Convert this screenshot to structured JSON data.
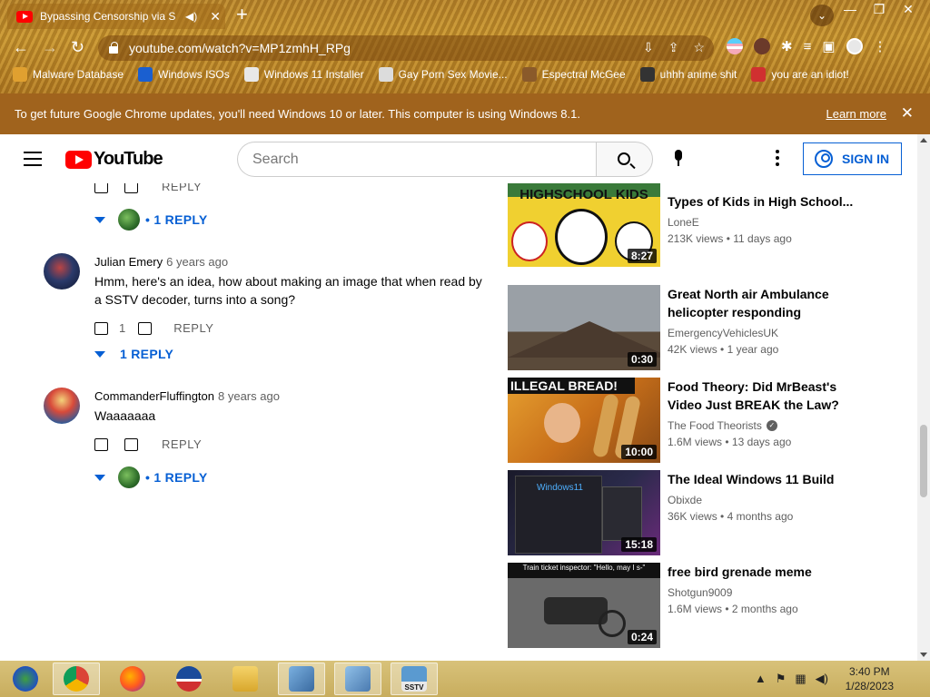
{
  "browser": {
    "tab_title": "Bypassing Censorship via SSTV",
    "url": "youtube.com/watch?v=MP1zmhH_RPg",
    "bookmarks": [
      {
        "label": "Malware Database",
        "color": "#e0a030"
      },
      {
        "label": "Windows ISOs",
        "color": "#1a5fd0"
      },
      {
        "label": "Windows 11 Installer",
        "color": "#e8e8e8"
      },
      {
        "label": "Gay Porn Sex Movie...",
        "color": "#dcdcdc"
      },
      {
        "label": "Espectral McGee",
        "color": "#8a5a2a"
      },
      {
        "label": "uhhh anime shit",
        "color": "#333333"
      },
      {
        "label": "you are an idiot!",
        "color": "#d03030"
      }
    ],
    "infobar_text": "To get future Google Chrome updates, you'll need Windows 10 or later. This computer is using Windows 8.1.",
    "infobar_link": "Learn more"
  },
  "youtube": {
    "logo_text": "YouTube",
    "search_placeholder": "Search",
    "signin_label": "SIGN IN"
  },
  "comments": {
    "top_reply_label": "REPLY",
    "top_replies_toggle": "• 1 REPLY",
    "items": [
      {
        "author": "Julian Emery",
        "time": "6 years ago",
        "text": "Hmm, here's an idea, how about making an image that when read by a SSTV decoder, turns into a song?",
        "likes": "1",
        "reply_label": "REPLY",
        "replies_toggle": "1 REPLY"
      },
      {
        "author": "CommanderFluffington",
        "time": "8 years ago",
        "text": "Waaaaaaa",
        "reply_label": "REPLY",
        "replies_toggle": "• 1 REPLY"
      }
    ]
  },
  "related": [
    {
      "title": "Types of Kids in High School...",
      "channel": "LoneE",
      "views": "213K views",
      "age": "11 days ago",
      "duration": "8:27",
      "thumb_text": "HIGHSCHOOL KIDS"
    },
    {
      "title": "Great North air Ambulance helicopter responding",
      "channel": "EmergencyVehiclesUK",
      "views": "42K views",
      "age": "1 year ago",
      "duration": "0:30"
    },
    {
      "title": "Food Theory: Did MrBeast's Video Just BREAK the Law?",
      "channel": "The Food Theorists",
      "views": "1.6M views",
      "age": "13 days ago",
      "duration": "10:00",
      "thumb_text": "ILLEGAL BREAD!"
    },
    {
      "title": "The Ideal Windows 11 Build",
      "channel": "Obixde",
      "views": "36K views",
      "age": "4 months ago",
      "duration": "15:18",
      "thumb_text": "Windows11"
    },
    {
      "title": "free bird grenade meme",
      "channel": "Shotgun9009",
      "views": "1.6M views",
      "age": "2 months ago",
      "duration": "0:24",
      "thumb_text": "Train ticket inspector: \"Hello, may I s-\""
    }
  ],
  "taskbar": {
    "time": "3:40 PM",
    "date": "1/28/2023",
    "apps": [
      "windows-media-center",
      "chrome",
      "firefox",
      "obama-logo-app",
      "file-explorer",
      "network-app",
      "network-app-2",
      "sstv-app"
    ],
    "sstv_label": "SSTV"
  },
  "colors": {
    "accent_blue": "#065fd4",
    "youtube_red": "#ff0000",
    "infobar_bg": "#a0631d"
  }
}
